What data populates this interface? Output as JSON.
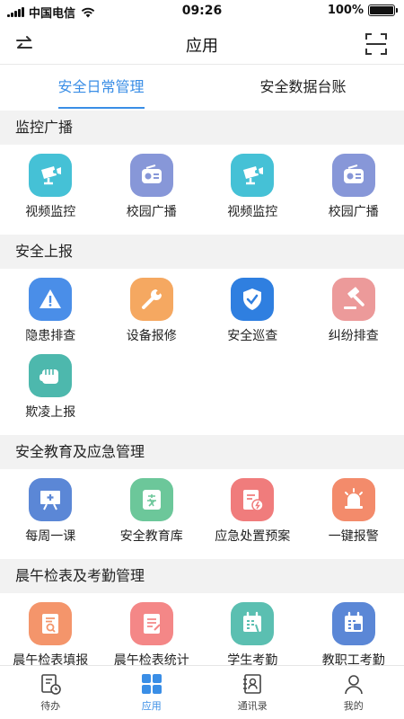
{
  "status_bar": {
    "carrier": "中国电信",
    "time": "09:26",
    "battery": "100%"
  },
  "nav": {
    "title": "应用"
  },
  "tabs": [
    {
      "label": "安全日常管理",
      "active": true
    },
    {
      "label": "安全数据台账",
      "active": false
    }
  ],
  "sections": [
    {
      "title": "监控广播",
      "items": [
        {
          "label": "视频监控",
          "icon": "camera-icon",
          "color": "#45c1d6"
        },
        {
          "label": "校园广播",
          "icon": "radio-icon",
          "color": "#8797d8"
        },
        {
          "label": "视频监控",
          "icon": "camera-icon",
          "color": "#45c1d6"
        },
        {
          "label": "校园广播",
          "icon": "radio-icon",
          "color": "#8797d8"
        }
      ]
    },
    {
      "title": "安全上报",
      "items": [
        {
          "label": "隐患排查",
          "icon": "warning-icon",
          "color": "#4a8ee8"
        },
        {
          "label": "设备报修",
          "icon": "wrench-icon",
          "color": "#f5a861"
        },
        {
          "label": "安全巡查",
          "icon": "shield-icon",
          "color": "#2f7fe0"
        },
        {
          "label": "纠纷排查",
          "icon": "gavel-icon",
          "color": "#ec9a9a"
        },
        {
          "label": "欺凌上报",
          "icon": "fist-icon",
          "color": "#4db8ad"
        }
      ]
    },
    {
      "title": "安全教育及应急管理",
      "items": [
        {
          "label": "每周一课",
          "icon": "lesson-icon",
          "color": "#5b87d6"
        },
        {
          "label": "安全教育库",
          "icon": "safety-library-icon",
          "color": "#6cc79a"
        },
        {
          "label": "应急处置预案",
          "icon": "emergency-plan-icon",
          "color": "#f07c7c"
        },
        {
          "label": "一键报警",
          "icon": "alarm-icon",
          "color": "#f38b6b"
        }
      ]
    },
    {
      "title": "晨午检表及考勤管理",
      "items": [
        {
          "label": "晨午检表填报",
          "icon": "checkform-fill-icon",
          "color": "#f4956b"
        },
        {
          "label": "晨午检表统计",
          "icon": "checkform-stats-icon",
          "color": "#f48787"
        },
        {
          "label": "学生考勤",
          "icon": "student-attendance-icon",
          "color": "#5bbfb1"
        },
        {
          "label": "教职工考勤",
          "icon": "staff-attendance-icon",
          "color": "#5b87d6"
        }
      ]
    }
  ],
  "bottom_nav": [
    {
      "label": "待办",
      "icon": "todo-icon",
      "active": false
    },
    {
      "label": "应用",
      "icon": "apps-icon",
      "active": true
    },
    {
      "label": "通讯录",
      "icon": "contacts-icon",
      "active": false
    },
    {
      "label": "我的",
      "icon": "profile-icon",
      "active": false
    }
  ],
  "colors": {
    "accent": "#3a8ee6",
    "section_bg": "#f2f2f2"
  }
}
